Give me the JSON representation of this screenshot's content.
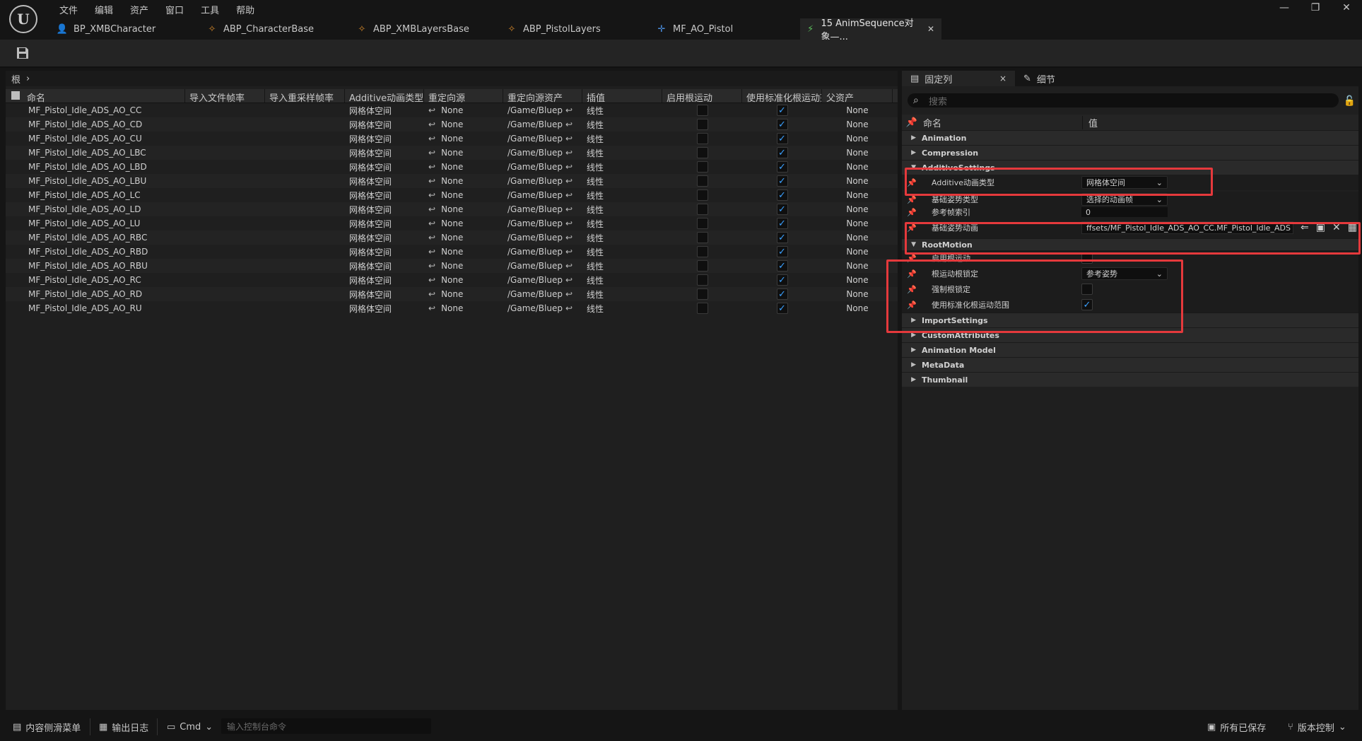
{
  "menu": [
    "文件",
    "编辑",
    "资产",
    "窗口",
    "工具",
    "帮助"
  ],
  "window_controls": {
    "minimize": "—",
    "maximize": "❐",
    "close": "✕"
  },
  "tabs": [
    {
      "label": "BP_XMBCharacter",
      "icon": "person-icon",
      "glyph": "👤",
      "color": "#4a8fe0"
    },
    {
      "label": "ABP_CharacterBase",
      "icon": "anim-bp-icon",
      "glyph": "✧",
      "color": "#d88a2a"
    },
    {
      "label": "ABP_XMBLayersBase",
      "icon": "anim-bp-icon",
      "glyph": "✧",
      "color": "#d88a2a"
    },
    {
      "label": "ABP_PistolLayers",
      "icon": "anim-bp-icon",
      "glyph": "✧",
      "color": "#d88a2a"
    },
    {
      "label": "MF_AO_Pistol",
      "icon": "blendspace-icon",
      "glyph": "✛",
      "color": "#4a8fe0"
    },
    {
      "label": "15 AnimSequence对象—...",
      "icon": "anim-sequence-icon",
      "glyph": "⚡",
      "color": "#5cbf5c",
      "active": true,
      "close": "✕"
    }
  ],
  "breadcrumb": {
    "root": "根",
    "arrow": "›"
  },
  "grid": {
    "headers": [
      "命名",
      "导入文件帧率",
      "导入重采样帧率",
      "Additive动画类型",
      "重定向源",
      "重定向源资产",
      "插值",
      "启用根运动",
      "使用标准化根运动范",
      "父资产"
    ],
    "row_values": {
      "additive": "网格体空间",
      "retarget": "None",
      "retarget_asset": "/Game/Blueprint",
      "interp": "线性",
      "parent": "None"
    },
    "rows": [
      "MF_Pistol_Idle_ADS_AO_CC",
      "MF_Pistol_Idle_ADS_AO_CD",
      "MF_Pistol_Idle_ADS_AO_CU",
      "MF_Pistol_Idle_ADS_AO_LBC",
      "MF_Pistol_Idle_ADS_AO_LBD",
      "MF_Pistol_Idle_ADS_AO_LBU",
      "MF_Pistol_Idle_ADS_AO_LC",
      "MF_Pistol_Idle_ADS_AO_LD",
      "MF_Pistol_Idle_ADS_AO_LU",
      "MF_Pistol_Idle_ADS_AO_RBC",
      "MF_Pistol_Idle_ADS_AO_RBD",
      "MF_Pistol_Idle_ADS_AO_RBU",
      "MF_Pistol_Idle_ADS_AO_RC",
      "MF_Pistol_Idle_ADS_AO_RD",
      "MF_Pistol_Idle_ADS_AO_RU"
    ],
    "root_motion_checked": false,
    "normalize_checked": true
  },
  "details": {
    "tab_pinned": "固定列",
    "tab_pinned_close": "×",
    "tab_details": "细节",
    "search_placeholder": "搜索",
    "col_name": "命名",
    "col_value": "值",
    "categories": {
      "animation": "Animation",
      "compression": "Compression",
      "additive": "AdditiveSettings",
      "rootmotion": "RootMotion",
      "import": "ImportSettings",
      "custom": "CustomAttributes",
      "animmodel": "Animation Model",
      "metadata": "MetaData",
      "thumbnail": "Thumbnail"
    },
    "props": {
      "additive_type_label": "Additive动画类型",
      "additive_type_value": "网格体空间",
      "base_pose_type_label": "基础姿势类型",
      "base_pose_type_value": "选择的动画帧",
      "ref_frame_label": "参考帧索引",
      "ref_frame_value": "0",
      "base_pose_anim_label": "基础姿势动画",
      "base_pose_anim_value": "ffsets/MF_Pistol_Idle_ADS_AO_CC.MF_Pistol_Idle_ADS",
      "enable_root_motion_label": "启用根运动",
      "root_motion_lock_label": "根运动根锁定",
      "root_motion_lock_value": "参考姿势",
      "force_root_lock_label": "强制根锁定",
      "normalize_label": "使用标准化根运动范围"
    }
  },
  "statusbar": {
    "content_drawer": "内容侧滑菜单",
    "output_log": "输出日志",
    "cmd": "Cmd",
    "cmd_placeholder": "输入控制台命令",
    "all_saved": "所有已保存",
    "source_control": "版本控制"
  },
  "colors": {
    "accent_check": "#3aa0ff",
    "highlight": "#e5393c"
  }
}
